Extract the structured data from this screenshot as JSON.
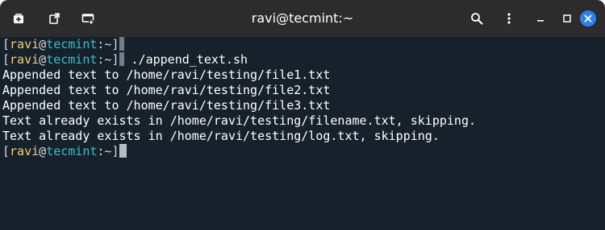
{
  "window": {
    "title": "ravi@tecmint:~"
  },
  "titlebar": {
    "icons": [
      "new-tab-icon",
      "detach-tab-icon",
      "new-window-icon",
      "search-icon",
      "menu-kebab-icon",
      "minimize-icon",
      "maximize-icon",
      "close-icon"
    ],
    "close_color": "#2f80ed"
  },
  "prompt": {
    "open_bracket": "[",
    "user": "ravi",
    "at": "@",
    "host": "tecmint",
    "path": ":~",
    "close_bracket": "]"
  },
  "terminal": {
    "lines": [
      {
        "type": "prompt",
        "command": ""
      },
      {
        "type": "prompt",
        "command": " ./append_text.sh"
      },
      {
        "type": "output",
        "text": "Appended text to /home/ravi/testing/file1.txt"
      },
      {
        "type": "output",
        "text": "Appended text to /home/ravi/testing/file2.txt"
      },
      {
        "type": "output",
        "text": "Appended text to /home/ravi/testing/file3.txt"
      },
      {
        "type": "output",
        "text": "Text already exists in /home/ravi/testing/filename.txt, skipping."
      },
      {
        "type": "output",
        "text": "Text already exists in /home/ravi/testing/log.txt, skipping."
      },
      {
        "type": "prompt",
        "command": ""
      }
    ],
    "colors": {
      "background": "#16212b",
      "user": "#f2d27a",
      "host": "#39c0c4",
      "text": "#ffffff"
    }
  }
}
